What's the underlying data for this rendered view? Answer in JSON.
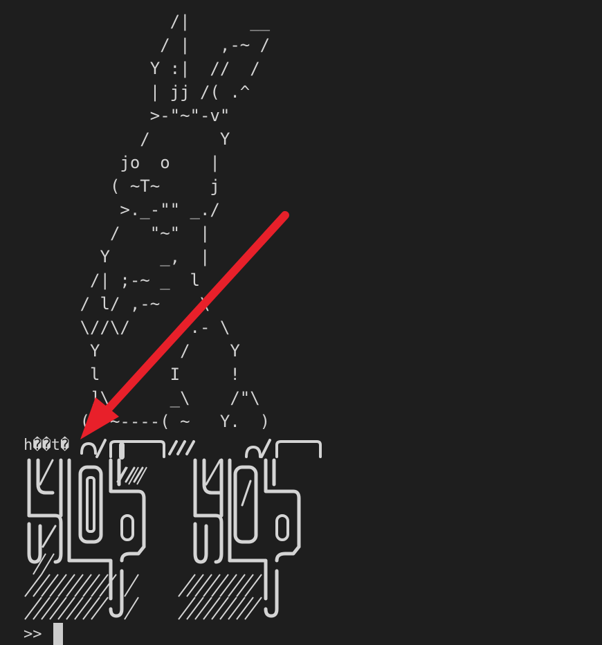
{
  "terminal": {
    "ascii_lines": [
      "                 /|      __",
      "                / |   ,-~ /",
      "               Y :|  //  /",
      "               | jj /( .^",
      "               >-\"~\"-v\"",
      "              /       Y",
      "            jo  o    |",
      "           ( ~T~     j",
      "            >._-\"\" _./",
      "           /   \"~\"  |",
      "          Y     _,  |",
      "         /| ;-~ _  l",
      "        / l/ ,-~    \\",
      "        \\//\\/      .- \\",
      "         Y        /    Y",
      "         l       I     !",
      "         ]\\      _\\    /\"\\",
      "        (\" ~----( ~   Y.  )"
    ],
    "garbled_text": "h��t�",
    "prompt": ">>",
    "colors": {
      "background": "#1e1e1e",
      "text": "#d4d4d4",
      "cursor": "#cccccc",
      "arrow": "#e8202a"
    }
  },
  "annotation": {
    "type": "arrow",
    "color": "#e8202a"
  }
}
